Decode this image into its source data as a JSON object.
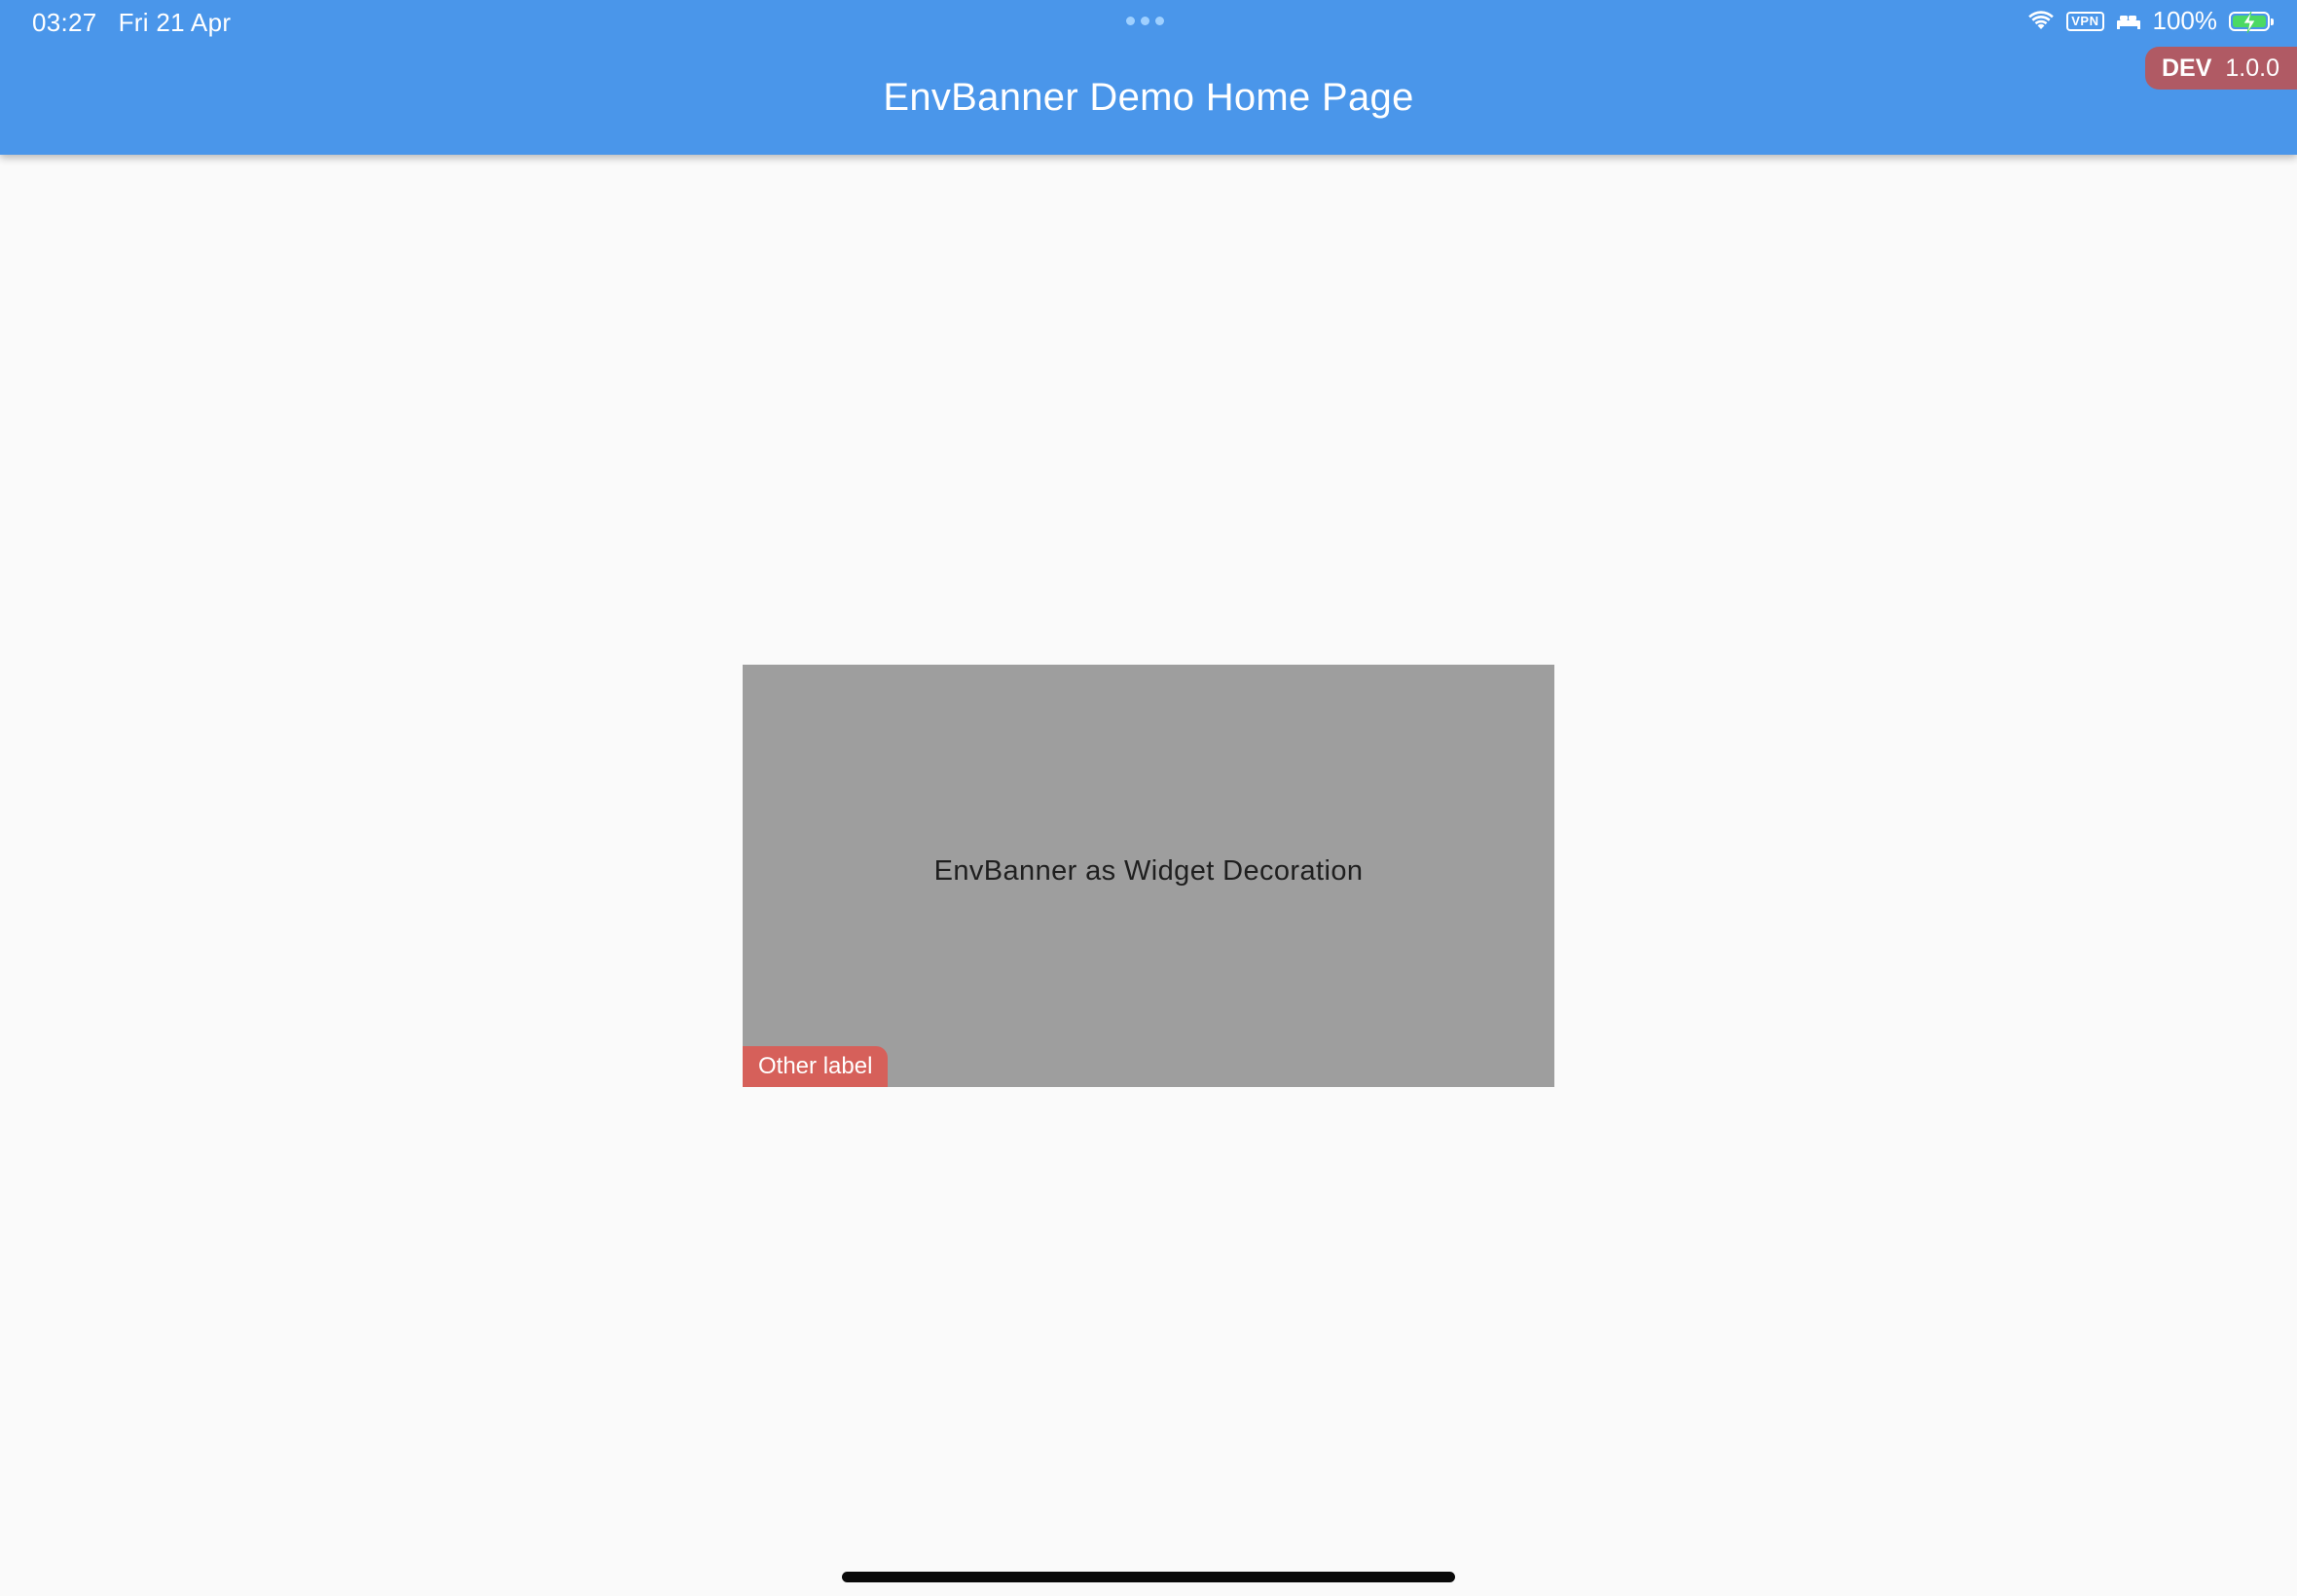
{
  "status_bar": {
    "time": "03:27",
    "date": "Fri 21 Apr",
    "vpn": "VPN",
    "battery": "100%",
    "battery_level": 1.0,
    "icons": [
      "wifi-icon",
      "vpn-icon",
      "bed-icon",
      "battery-icon",
      "charging-bolt-icon"
    ]
  },
  "app_bar": {
    "title": "EnvBanner Demo Home Page",
    "background_color": "#4a96ea"
  },
  "env_banner": {
    "environment": "DEV",
    "version": "1.0.0",
    "color": "#b05a64"
  },
  "decorated_widget": {
    "text": "EnvBanner as Widget Decoration",
    "label": "Other label",
    "label_color": "#d6605a",
    "background_color": "#9e9e9e"
  }
}
